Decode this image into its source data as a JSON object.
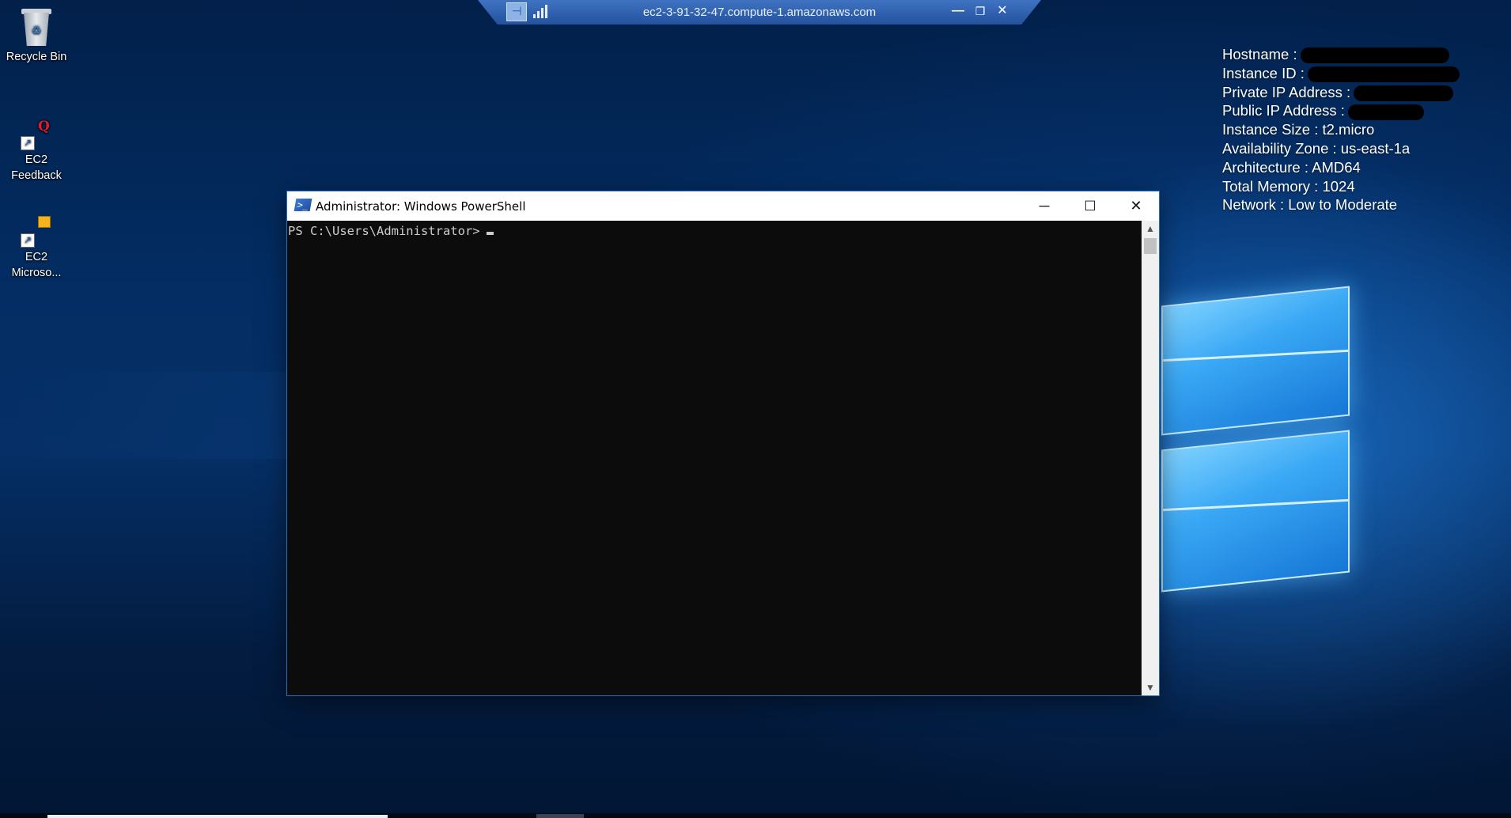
{
  "rdp_bar": {
    "title": "ec2-3-91-32-47.compute-1.amazonaws.com",
    "pin_icon": "pin-icon",
    "signal_icon": "connection-signal-icon",
    "minimize_glyph": "—",
    "restore_glyph": "❐",
    "close_glyph": "✕"
  },
  "desktop_icons": [
    {
      "label_line1": "Recycle Bin",
      "label_line2": "",
      "icon": "recycle-bin-icon"
    },
    {
      "label_line1": "EC2",
      "label_line2": "Feedback",
      "icon": "ec2-feedback-icon"
    },
    {
      "label_line1": "EC2",
      "label_line2": "Microso...",
      "icon": "ec2-microsoft-icon"
    }
  ],
  "sysinfo": {
    "hostname_label": "Hostname :",
    "instance_id_label": "Instance ID :",
    "private_ip_label": "Private IP Address :",
    "public_ip_label": "Public IP Address :",
    "instance_size": "Instance Size : t2.micro",
    "availability_zone": "Availability Zone : us-east-1a",
    "architecture": "Architecture : AMD64",
    "total_memory": "Total Memory : 1024",
    "network": "Network : Low to Moderate"
  },
  "powershell": {
    "title": "Administrator: Windows PowerShell",
    "prompt": "PS C:\\Users\\Administrator>",
    "minimize_glyph": "─",
    "maximize_glyph": "☐",
    "close_glyph": "✕",
    "scroll_up": "▲",
    "scroll_down": "▼"
  }
}
